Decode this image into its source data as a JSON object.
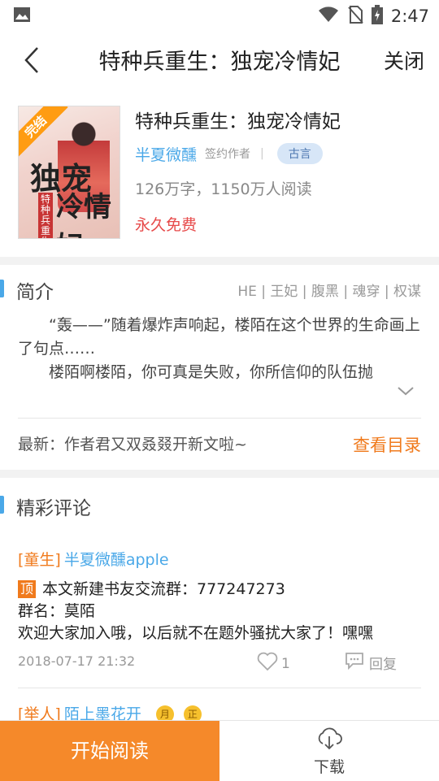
{
  "status": {
    "time": "2:47"
  },
  "nav": {
    "title": "特种兵重生：独宠冷情妃",
    "close": "关闭"
  },
  "book": {
    "cover": {
      "badge": "完结",
      "title_line1": "独宠",
      "title_line2": "冷情妃",
      "tag": "特种兵重生"
    },
    "title": "特种兵重生：独宠冷情妃",
    "author": "半夏微醺",
    "author_role": "签约作者",
    "separator": "|",
    "genre": "古言",
    "count": "126万字，1150万人阅读",
    "free": "永久免费"
  },
  "intro": {
    "heading": "简介",
    "tags": "HE | 王妃 | 腹黑 | 魂穿 | 权谋",
    "para1": "“轰——”随着爆炸声响起，楼陌在这个世界的生命画上了句点……",
    "para2": "楼陌啊楼陌，你可真是失败，你所信仰的队伍抛",
    "latest": "最新：作者君又双叒叕开新文啦~",
    "toc": "查看目录"
  },
  "comments": {
    "heading": "精彩评论",
    "items": [
      {
        "level": "[童生]",
        "name": "半夏微醺apple",
        "top_badge": "顶",
        "line1": "本文新建书友交流群：777247273",
        "line2": "群名：莫陌",
        "line3": "欢迎大家加入哦，以后就不在题外骚扰大家了！嘿嘿",
        "time": "2018-07-17 21:32",
        "likes": "1",
        "reply": "回复"
      },
      {
        "level": "[举人]",
        "name": "陌上墨花开",
        "medal1": "月",
        "medal2": "正"
      }
    ]
  },
  "bottom": {
    "read": "开始阅读",
    "download": "下载"
  },
  "colors": {
    "accent": "#f5892a",
    "link": "#4aa8e8",
    "free": "#e74a4a"
  }
}
